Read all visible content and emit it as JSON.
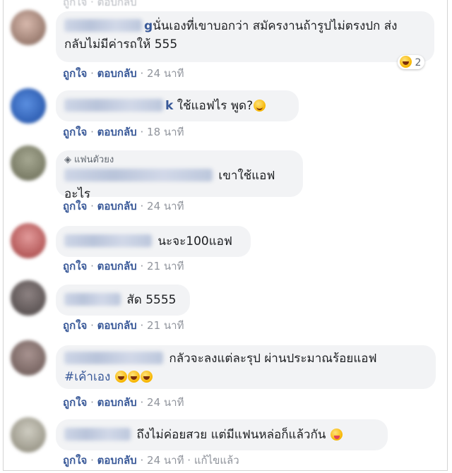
{
  "actions": {
    "like": "ถูกใจ",
    "reply": "ตอบกลับ",
    "sep": "·",
    "edited": "แก้ไขแล้ว"
  },
  "top_fragment": "ถูกใจ · ตอบกลับ",
  "comments": [
    {
      "name_tail": "g",
      "text_line1": "นั่นเองที่เขาบอกว่า สมัครงานถ้ารูปไม่ตรงปก ส่ง",
      "text_line2": "กลับไม่มีค่ารถให้ 555",
      "time": "24 นาที",
      "reaction": {
        "icon": "laughing-face-icon",
        "count": "2"
      }
    },
    {
      "name_tail": "k",
      "text": "ใช้แอฟไร พูด?",
      "emoji": "smiling-face-icon",
      "time": "18 นาที"
    },
    {
      "badge": "แฟนตัวยง",
      "badge_icon": "diamond-icon",
      "text": "เขาใช้แอฟอะไร",
      "time": "24 นาที"
    },
    {
      "text": "นะจะ100แอฟ",
      "time": "21 นาที"
    },
    {
      "text": "สัด 5555",
      "time": "21 นาที"
    },
    {
      "text_line1": "กลัวจะลงแต่ละรุป ผ่านประมาณร้อยแอฟ",
      "text_line2": "#เค้าเอง",
      "emoji": "rolling-laughing-face-icon",
      "time": "24 นาที"
    },
    {
      "text": "ถึงไม่ค่อยสวย แต่มีแฟนหล่อก็แล้วกัน",
      "emoji": "winking-tongue-face-icon",
      "time": "24 นาที",
      "edited": true
    }
  ],
  "colors": {
    "bubble": "#f2f3f5",
    "link": "#385898",
    "muted": "#90949c",
    "avatars": [
      "#b79c90",
      "#4a78c4",
      "#8c8f7a",
      "#c66a6a",
      "#6b6060",
      "#8e7a76",
      "#b3b1a6"
    ]
  }
}
